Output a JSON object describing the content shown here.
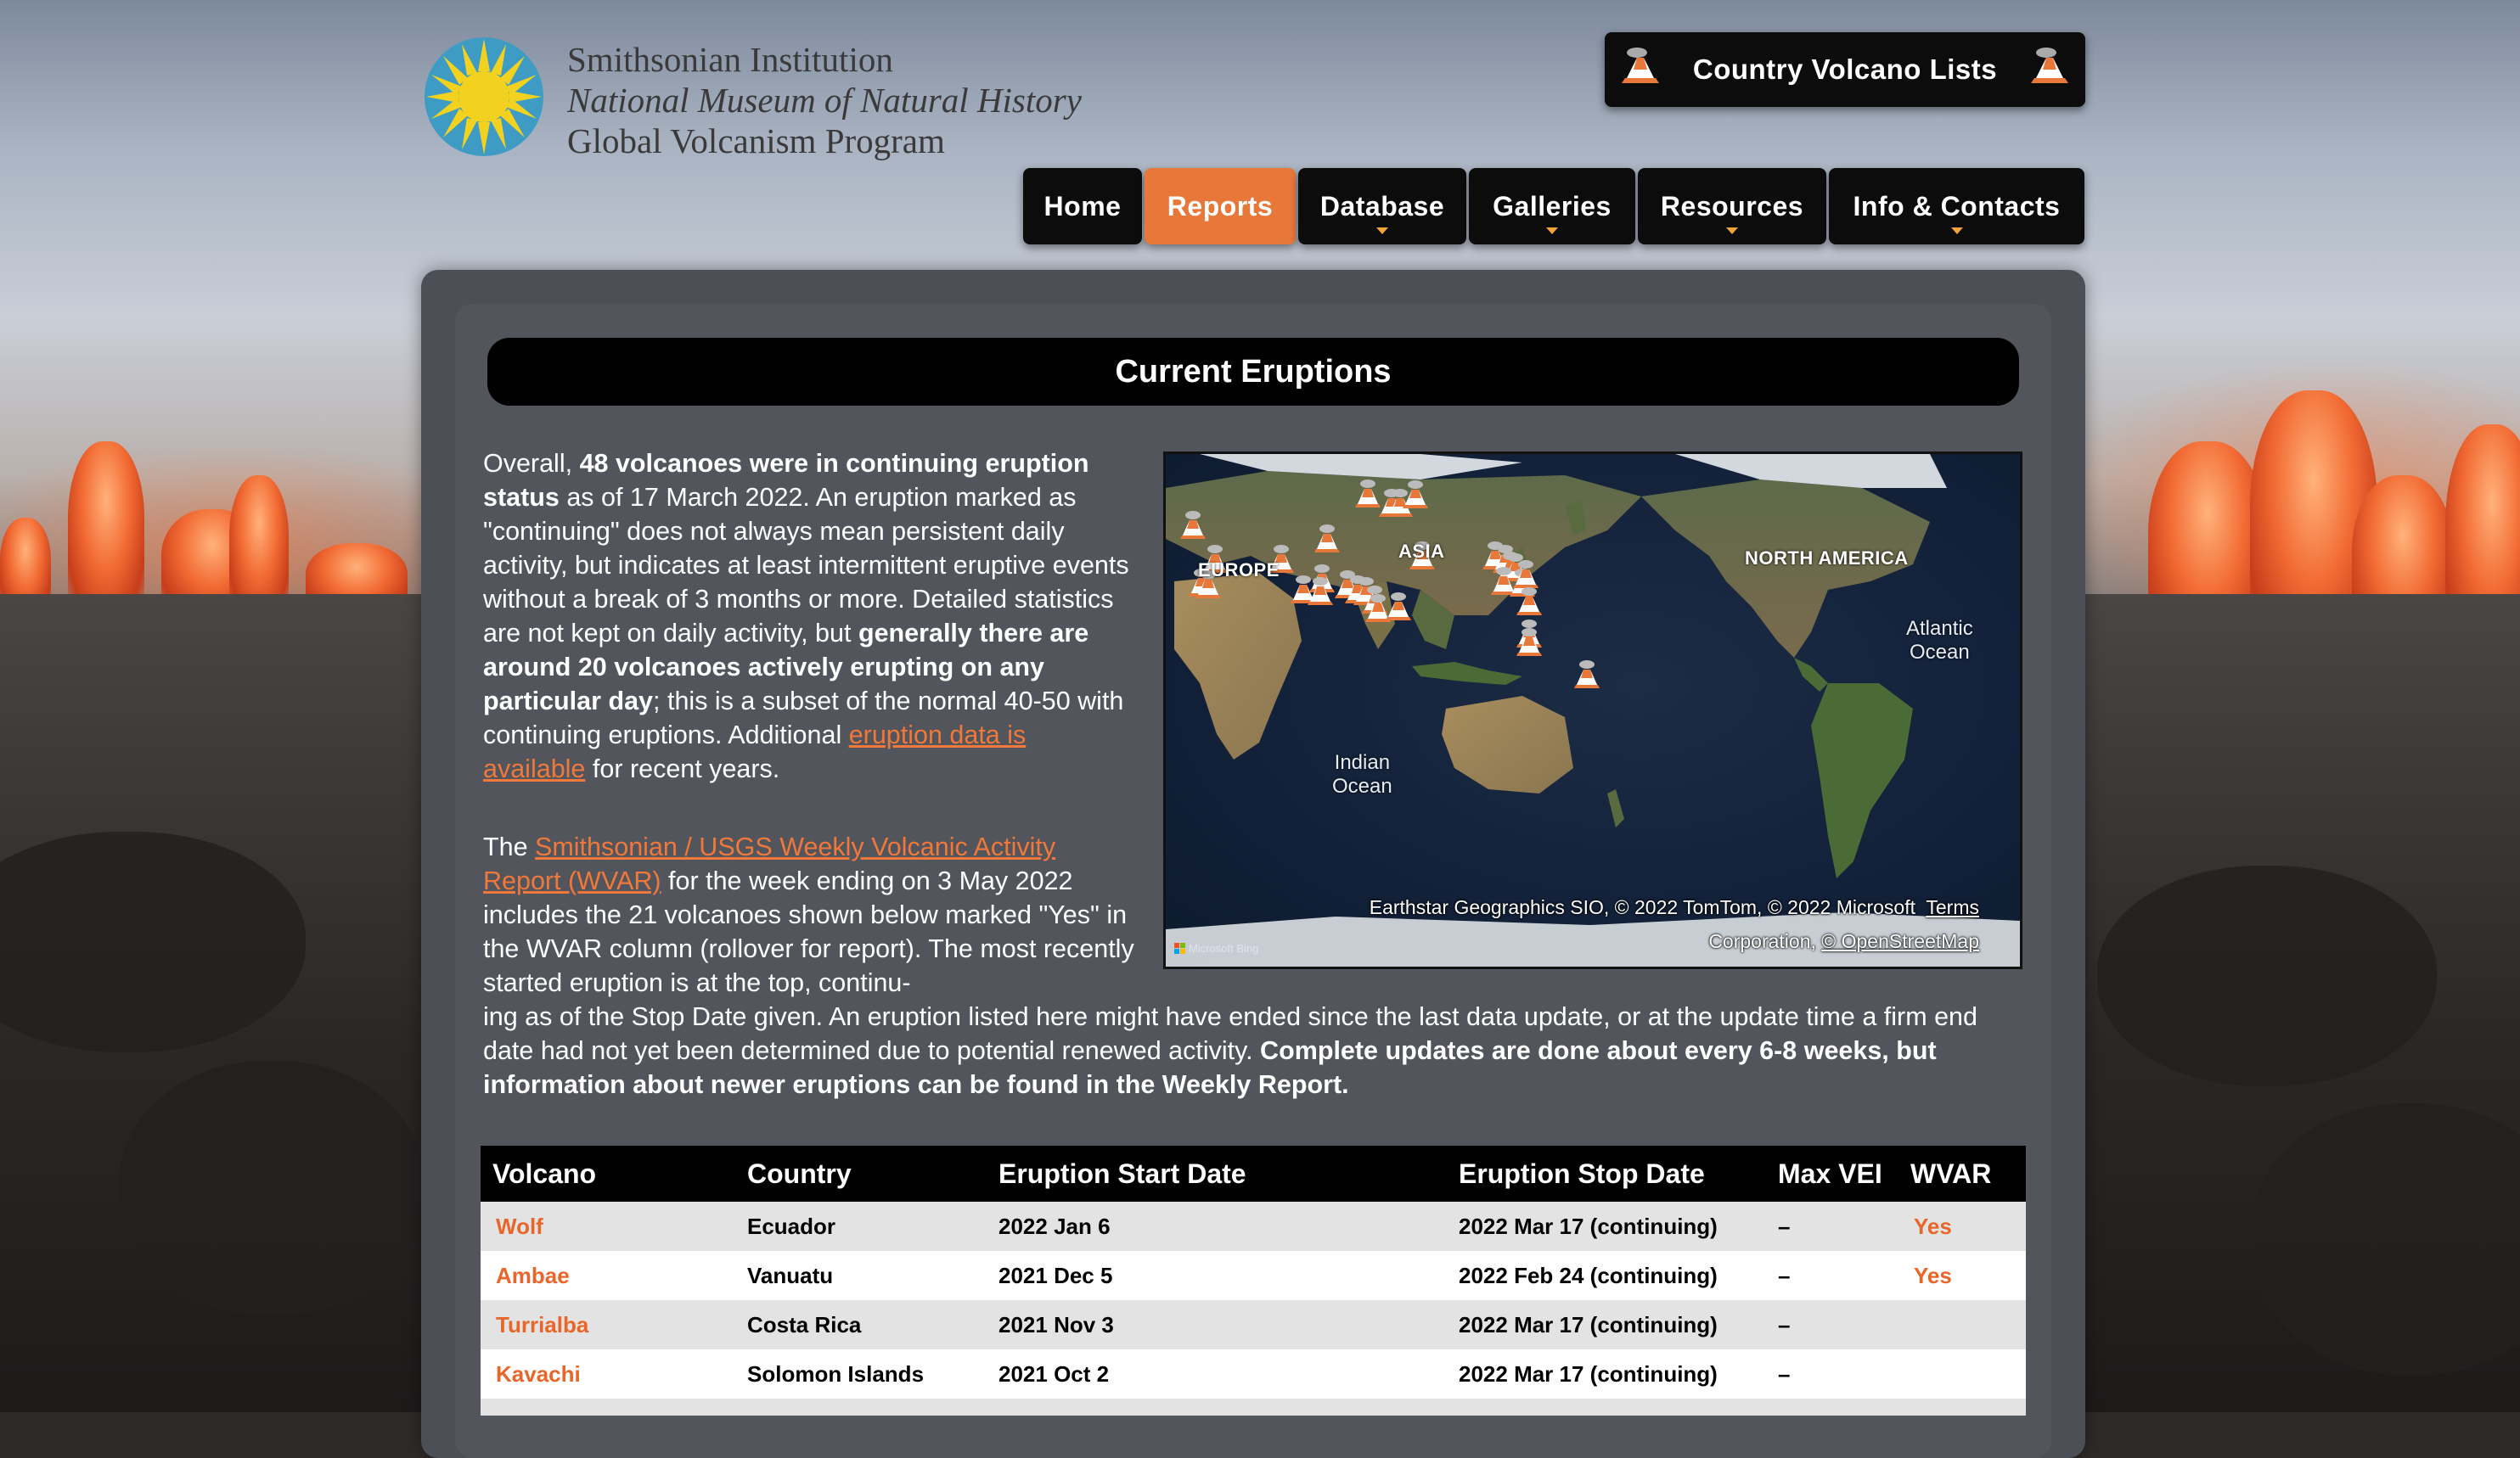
{
  "header": {
    "logo_line1": "Smithsonian Institution",
    "logo_line2": "National Museum of Natural History",
    "logo_line3": "Global Volcanism Program",
    "country_button": "Country Volcano Lists"
  },
  "nav": {
    "items": [
      {
        "label": "Home",
        "active": false,
        "dropdown": false
      },
      {
        "label": "Reports",
        "active": true,
        "dropdown": false
      },
      {
        "label": "Database",
        "active": false,
        "dropdown": true
      },
      {
        "label": "Galleries",
        "active": false,
        "dropdown": true
      },
      {
        "label": "Resources",
        "active": false,
        "dropdown": true
      },
      {
        "label": "Info & Contacts",
        "active": false,
        "dropdown": true
      }
    ]
  },
  "main": {
    "title": "Current Eruptions",
    "para1": {
      "t1": "Overall, ",
      "b1": "48 volcanoes were in continuing eruption status",
      "t2": " as of 17 March 2022. An eruption marked as \"continuing\" does not always mean persistent daily activity, but indicates at least intermittent eruptive events without a break of 3 months or more. Detailed statistics are not kept on daily activity, but ",
      "b2": "generally there are around 20 volcanoes actively erupting on any particular day",
      "t3": "; this is a subset of the normal 40-50 with continuing eruptions. Additional ",
      "link": "eruption data is available",
      "t4": " for recent years."
    },
    "para2": {
      "t1": "The ",
      "link": "Smithsonian / USGS Weekly Volcanic Activity Report (WVAR)",
      "t2": " for the week ending on 3 May 2022 includes the 21 volcanoes shown below marked \"Yes\" in the WVAR column (rollover for report). The most recently started eruption is at the top, continu-",
      "t3": "ing as of the Stop Date given. An eruption listed here might have ended since the last data update, or at the update time a firm end date had not yet been determined due to potential renewed activity. ",
      "b1": "Complete updates are done about every 6-8 weeks, but information about newer eruptions can be found in the Weekly Report."
    }
  },
  "map": {
    "labels": {
      "europe": "EUROPE",
      "asia": "ASIA",
      "north_america": "NORTH AMERICA",
      "atlantic1": "Atlantic",
      "atlantic2": "Ocean",
      "indian1": "Indian",
      "indian2": "Ocean"
    },
    "credit_line1": "Earthstar Geographics SIO, © 2022 TomTom, © 2022 Microsoft",
    "credit_terms": "Terms",
    "credit_line2a": "Corporation, ",
    "credit_osm": "© OpenStreetMap",
    "ms_logo": "Microsoft Bing",
    "volcano_icon": "volcano-icon",
    "volcano_count_shown": 38
  },
  "table": {
    "headers": [
      "Volcano",
      "Country",
      "Eruption Start Date",
      "Eruption Stop Date",
      "Max VEI",
      "WVAR"
    ],
    "rows": [
      {
        "volcano": "Wolf",
        "country": "Ecuador",
        "start": "2022 Jan 6",
        "stop": "2022 Mar 17 (continuing)",
        "vei": "–",
        "wvar": "Yes"
      },
      {
        "volcano": "Ambae",
        "country": "Vanuatu",
        "start": "2021 Dec 5",
        "stop": "2022 Feb 24 (continuing)",
        "vei": "–",
        "wvar": "Yes"
      },
      {
        "volcano": "Turrialba",
        "country": "Costa Rica",
        "start": "2021 Nov 3",
        "stop": "2022 Mar 17 (continuing)",
        "vei": "–",
        "wvar": ""
      },
      {
        "volcano": "Kavachi",
        "country": "Solomon Islands",
        "start": "2021 Oct 2",
        "stop": "2022 Mar 17 (continuing)",
        "vei": "–",
        "wvar": ""
      }
    ]
  },
  "colors": {
    "accent_orange": "#e8783a",
    "link_orange": "#f0783a",
    "nav_black": "#0c0c0c",
    "panel_gray": "#52555c"
  }
}
